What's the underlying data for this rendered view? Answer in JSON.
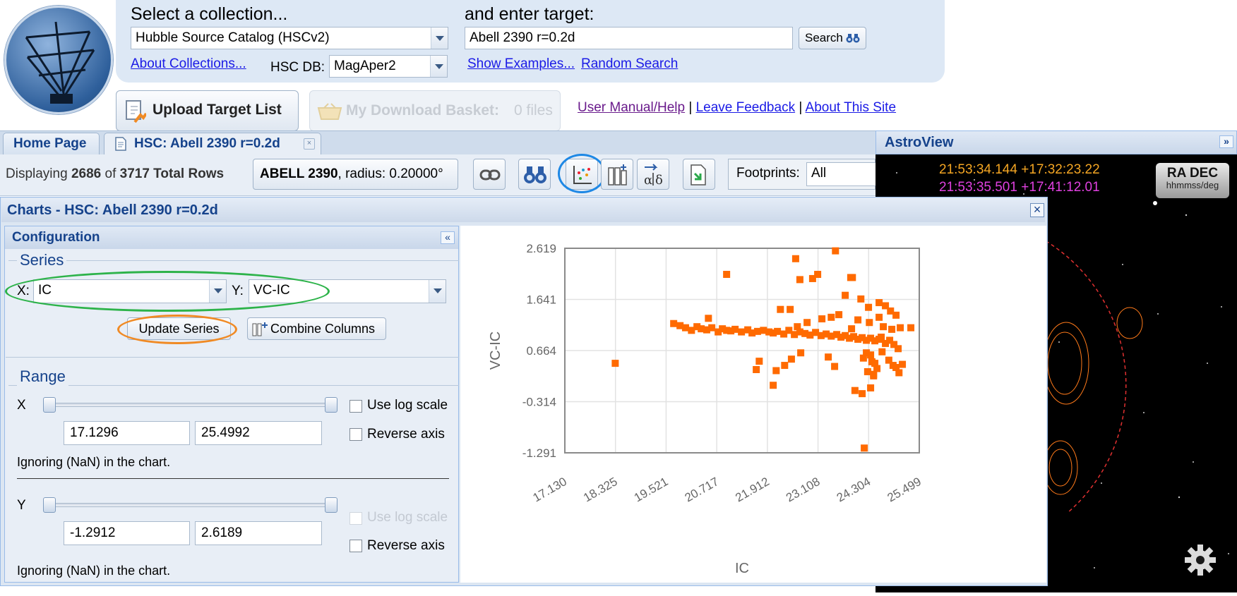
{
  "header": {
    "collection_label": "Select a collection...",
    "collection_value": "Hubble Source Catalog (HSCv2)",
    "about_collections": "About Collections...",
    "hsc_db_label": "HSC DB:",
    "hsc_db_value": "MagAper2",
    "target_label": "and enter target:",
    "target_value": "Abell 2390 r=0.2d",
    "search_button": "Search",
    "show_examples": "Show Examples...",
    "random_search": "Random Search",
    "upload_button": "Upload Target List",
    "basket_label": "My Download Basket:",
    "basket_count": "0 files",
    "user_manual": "User Manual/Help",
    "leave_feedback": "Leave Feedback",
    "about_site": "About This Site",
    "sep": "|"
  },
  "tabs": {
    "home": "Home Page",
    "hsc": "HSC: Abell 2390 r=0.2d"
  },
  "toolbar": {
    "displaying_prefix": "Displaying",
    "displaying_count": "2686",
    "displaying_of": "of",
    "total_rows": "3717 Total Rows",
    "target_name": "ABELL 2390",
    "target_radius": ", radius: 0.20000°",
    "footprints_label": "Footprints:",
    "footprints_value": "All"
  },
  "charts": {
    "window_title": "Charts - HSC: Abell 2390 r=0.2d",
    "config_title": "Configuration",
    "series_legend": "Series",
    "x_label": "X:",
    "x_value": "IC",
    "y_label": "Y:",
    "y_value": "VC-IC",
    "update_series": "Update Series",
    "combine_columns": "Combine Columns",
    "range_legend": "Range",
    "range_x_label": "X",
    "range_x_min": "17.1296",
    "range_x_max": "25.4992",
    "range_y_label": "Y",
    "range_y_min": "-1.2912",
    "range_y_max": "2.6189",
    "use_log_scale": "Use log scale",
    "reverse_axis": "Reverse axis",
    "ignoring_nan": "Ignoring (NaN) in the chart."
  },
  "astroview": {
    "title": "AstroView",
    "coord1": "21:53:34.144 +17:32:23.22",
    "coord2": "21:53:35.501 +17:41:12.01",
    "ra_dec": "RA DEC",
    "ra_dec_unit": "hhmmss/deg",
    "coord1_color": "#f5a623",
    "coord2_color": "#e040e0"
  },
  "colors": {
    "accent_blue": "#15428b",
    "marker_orange": "#ff6a00",
    "highlight_green": "#2db34a",
    "highlight_orange": "#f08a24",
    "highlight_blue": "#1e88e5"
  },
  "chart_data": {
    "type": "scatter",
    "xlabel": "IC",
    "ylabel": "VC-IC",
    "xlim": [
      17.13,
      25.499
    ],
    "ylim": [
      -1.291,
      2.619
    ],
    "x_ticks": [
      "17.130",
      "18.325",
      "19.521",
      "20.717",
      "21.912",
      "23.108",
      "24.304",
      "25.499"
    ],
    "y_ticks": [
      "2.619",
      "1.641",
      "0.664",
      "-0.314",
      "-1.291"
    ],
    "grid": true,
    "x": [
      18.32,
      19.7,
      19.85,
      19.98,
      20.12,
      20.25,
      20.35,
      20.48,
      20.6,
      20.75,
      20.85,
      20.95,
      21.05,
      21.15,
      21.3,
      21.45,
      21.55,
      21.68,
      21.82,
      21.95,
      22.05,
      22.15,
      22.3,
      22.42,
      22.55,
      22.68,
      22.8,
      22.92,
      23.05,
      23.18,
      23.3,
      23.42,
      23.55,
      23.65,
      23.75,
      23.85,
      23.95,
      24.05,
      24.15,
      24.25,
      24.35,
      24.45,
      24.55,
      24.6,
      24.7,
      24.8,
      24.9,
      25.0,
      20.52,
      20.95,
      22.58,
      22.68,
      22.98,
      23.1,
      23.52,
      23.88,
      23.92,
      23.75,
      24.12,
      24.3,
      24.55,
      24.7,
      24.82,
      24.95,
      22.22,
      22.45,
      22.62,
      22.85,
      23.2,
      23.42,
      23.6,
      23.9,
      24.05,
      24.32,
      24.55,
      24.65,
      24.85,
      25.05,
      25.3,
      24.18,
      24.35,
      24.45,
      24.62,
      24.78,
      24.95,
      24.25,
      24.38,
      24.5,
      24.88,
      25.02,
      24.42,
      21.65,
      21.72,
      22.12,
      22.32,
      22.48,
      23.35,
      23.5,
      24.28,
      24.42,
      25.1,
      24.35,
      23.98,
      24.15,
      24.2,
      22.05,
      22.7
    ],
    "y": [
      0.42,
      1.18,
      1.14,
      1.1,
      1.05,
      1.12,
      1.08,
      1.06,
      1.1,
      1.02,
      1.08,
      1.05,
      1.04,
      1.07,
      1.02,
      1.06,
      1.0,
      1.03,
      1.05,
      1.02,
      1.0,
      1.03,
      0.98,
      1.05,
      0.97,
      1.02,
      0.99,
      0.96,
      1.01,
      0.95,
      0.98,
      0.94,
      0.97,
      0.92,
      0.95,
      0.9,
      0.93,
      0.88,
      0.91,
      0.86,
      0.9,
      0.85,
      0.88,
      0.92,
      0.8,
      0.86,
      0.78,
      0.7,
      1.28,
      2.12,
      2.42,
      2.02,
      2.04,
      2.12,
      2.57,
      2.06,
      2.06,
      1.72,
      1.65,
      1.49,
      1.58,
      1.52,
      1.42,
      1.34,
      1.45,
      1.45,
      1.12,
      1.2,
      1.27,
      1.3,
      1.35,
      1.08,
      1.25,
      1.2,
      1.3,
      1.12,
      1.07,
      1.1,
      1.1,
      0.52,
      0.58,
      0.42,
      0.64,
      0.48,
      0.34,
      0.62,
      0.45,
      0.32,
      0.38,
      0.24,
      0.18,
      0.3,
      0.46,
      0.28,
      0.38,
      0.5,
      0.54,
      0.36,
      0.26,
      0.21,
      0.4,
      -0.05,
      -0.1,
      -0.16,
      -1.2,
      0.0,
      0.62
    ]
  }
}
